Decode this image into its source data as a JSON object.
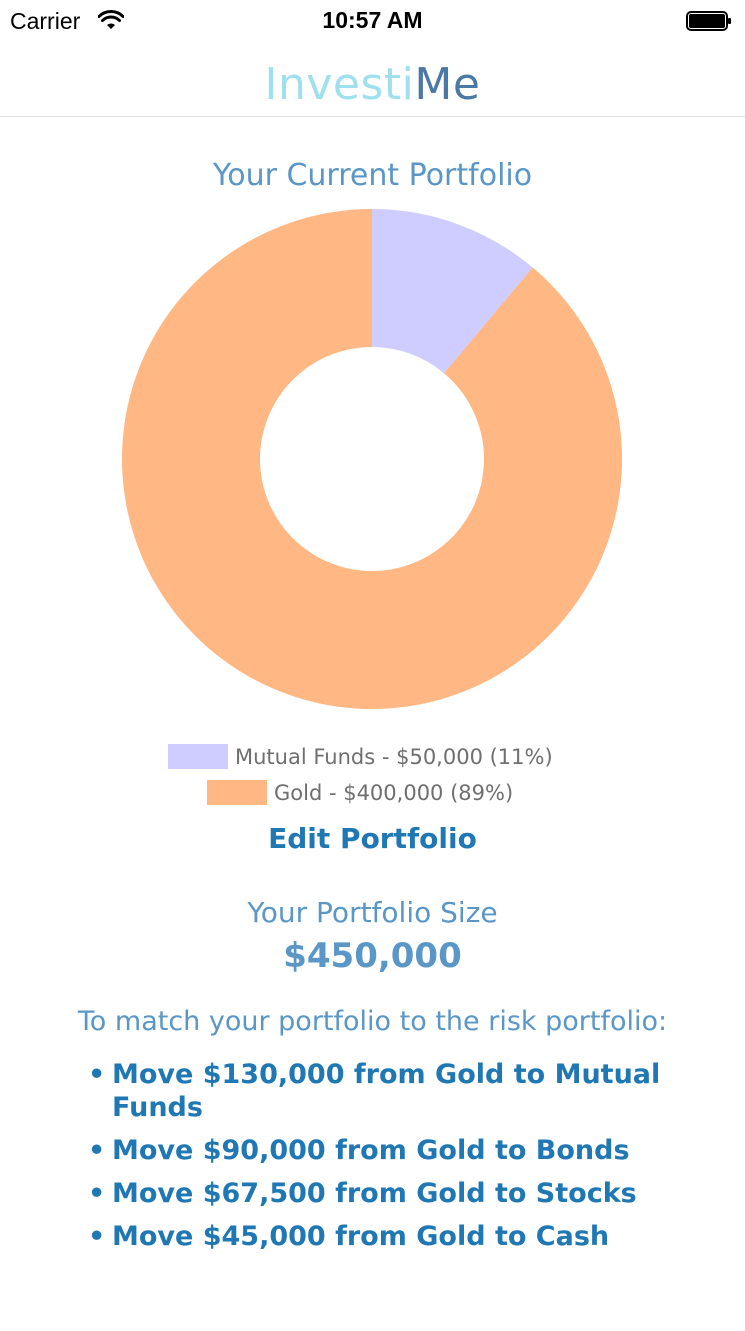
{
  "status_bar": {
    "carrier": "Carrier",
    "time": "10:57 AM",
    "battery_level": 1.0
  },
  "app": {
    "title_part1": "Investi",
    "title_part2": "Me",
    "title_color1": "#9fe0ee",
    "title_color2": "#4a79a5"
  },
  "portfolio": {
    "heading": "Your Current Portfolio",
    "edit_label": "Edit Portfolio"
  },
  "chart_data": {
    "type": "pie",
    "title": "Your Current Portfolio",
    "slices": [
      {
        "label": "Mutual Funds - $50,000 (11%)",
        "value": 50000,
        "color": "#cfcdff"
      },
      {
        "label": "Gold - $400,000 (89%)",
        "value": 400000,
        "color": "#ffb784"
      }
    ],
    "legend": "bottom"
  },
  "size": {
    "label": "Your Portfolio Size",
    "value": "$450,000"
  },
  "recommendations": {
    "heading": "To match your portfolio to the risk portfolio:",
    "items": [
      "Move $130,000 from Gold to Mutual Funds",
      "Move $90,000 from Gold to Bonds",
      "Move $67,500 from Gold to Stocks",
      "Move $45,000 from Gold to Cash"
    ]
  }
}
